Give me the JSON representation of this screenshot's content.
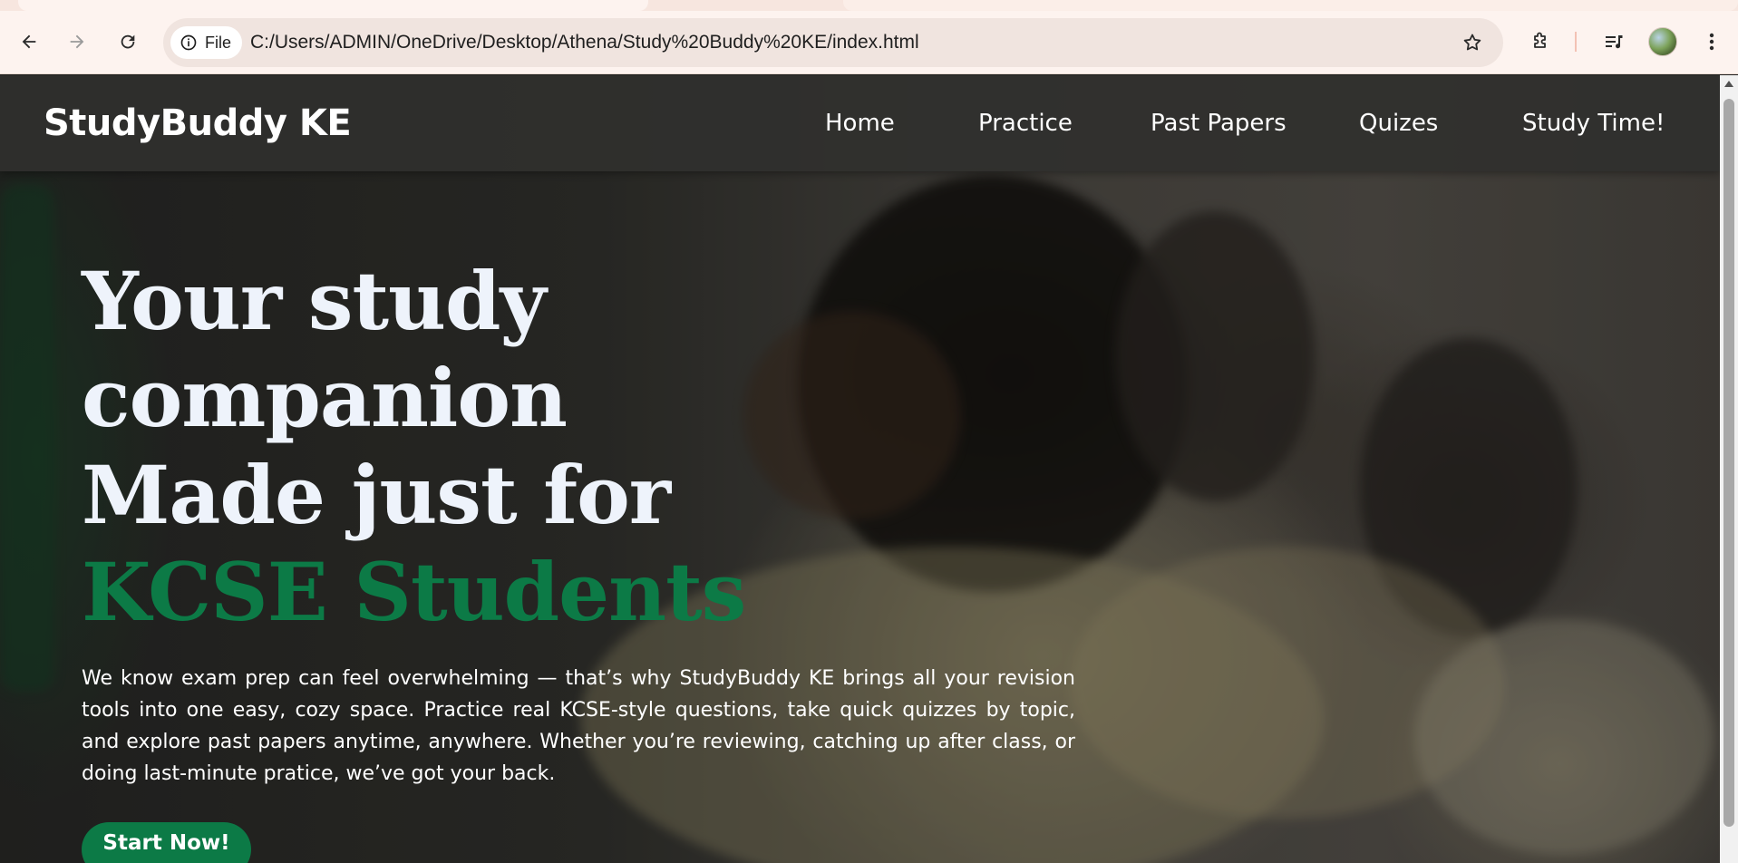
{
  "browser": {
    "address_chip": "File",
    "url": "C:/Users/ADMIN/OneDrive/Desktop/Athena/Study%20Buddy%20KE/index.html",
    "icons": [
      "back-arrow-icon",
      "forward-arrow-icon",
      "reload-icon",
      "info-icon",
      "bookmark-star-icon",
      "extensions-puzzle-icon",
      "media-queue-icon",
      "profile-avatar",
      "menu-kebab-icon"
    ]
  },
  "site": {
    "logo": "StudyBuddy KE",
    "nav": [
      {
        "label": "Home"
      },
      {
        "label": "Practice"
      },
      {
        "label": "Past Papers"
      },
      {
        "label": "Quizes"
      },
      {
        "label": "Study Time!"
      }
    ]
  },
  "hero": {
    "title_lines": [
      "Your study",
      "companion",
      "Made just for"
    ],
    "title_accent": "KCSE Students",
    "description": "We know exam prep can feel overwhelming — that’s why StudyBuddy KE brings all your revision tools into one easy, cozy space. Practice real KCSE-style questions, take quick quizzes by topic, and explore past papers anytime, anywhere. Whether you’re reviewing, catching up after class, or doing last-minute pratice, we’ve got your back.",
    "cta_label": "Start Now!"
  },
  "colors": {
    "accent_green": "#0c7a46",
    "nav_bar": "#30302e",
    "title_text": "#eef3fb",
    "browser_toolbar": "#fdf3ef"
  }
}
